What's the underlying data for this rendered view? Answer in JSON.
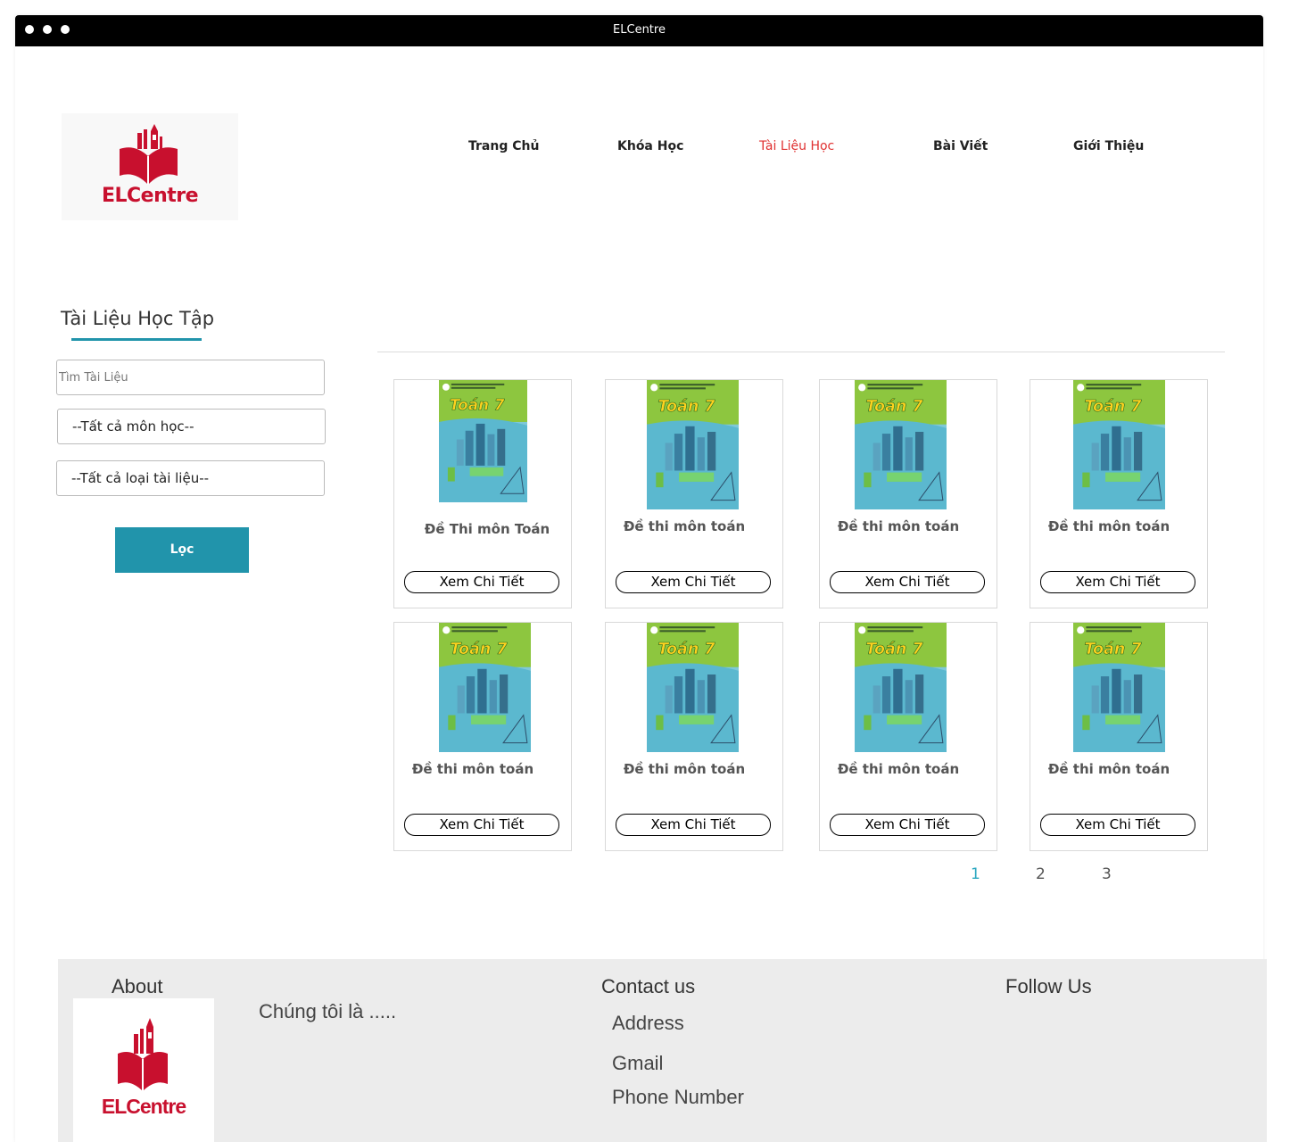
{
  "window": {
    "title": "ELCentre"
  },
  "brand": {
    "name": "ELCentre"
  },
  "nav": {
    "items": [
      {
        "label": "Trang Chủ"
      },
      {
        "label": "Khóa Học"
      },
      {
        "label": "Tài Liệu Học",
        "active": true
      },
      {
        "label": "Bài Viết"
      },
      {
        "label": "Giới Thiệu"
      }
    ]
  },
  "sidebar": {
    "title": "Tài Liệu Học Tập",
    "search_placeholder": "Tìm Tài Liệu",
    "subject_select": "--Tất cả môn học--",
    "type_select": "--Tất cả loại tài liệu--",
    "filter_label": "Lọc"
  },
  "documents": [
    {
      "title": "Đề Thi môn Toán",
      "button": "Xem Chi Tiết",
      "cover_text": "Toán 7"
    },
    {
      "title": "Đề thi môn toán",
      "button": "Xem Chi Tiết",
      "cover_text": "Toán 7"
    },
    {
      "title": "Đề thi môn toán",
      "button": "Xem Chi Tiết",
      "cover_text": "Toán 7"
    },
    {
      "title": "Đề thi môn toán",
      "button": "Xem Chi Tiết",
      "cover_text": "Toán 7"
    },
    {
      "title": "Đề thi môn toán",
      "button": "Xem Chi Tiết",
      "cover_text": "Toán 7"
    },
    {
      "title": "Đề thi môn toán",
      "button": "Xem Chi Tiết",
      "cover_text": "Toán 7"
    },
    {
      "title": "Đề thi môn toán",
      "button": "Xem Chi Tiết",
      "cover_text": "Toán 7"
    },
    {
      "title": "Đề thi môn toán",
      "button": "Xem Chi Tiết",
      "cover_text": "Toán 7"
    }
  ],
  "pagination": {
    "pages": [
      "1",
      "2",
      "3"
    ],
    "current": "1"
  },
  "footer": {
    "about_heading": "About",
    "about_text": "Chúng tôi là .....",
    "contact_heading": "Contact us",
    "address": "Address",
    "gmail": "Gmail",
    "phone": "Phone Number",
    "follow_heading": "Follow Us"
  },
  "colors": {
    "accent": "#2194ab",
    "brand_red": "#c8102e",
    "active_nav": "#e03131",
    "footer_bg": "#ececec"
  }
}
